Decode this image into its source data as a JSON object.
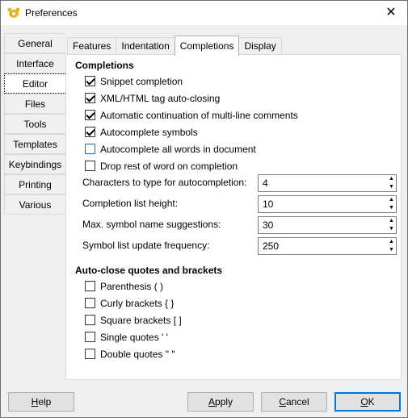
{
  "window": {
    "title": "Preferences",
    "close_glyph": "✕"
  },
  "categories": [
    {
      "label": "General"
    },
    {
      "label": "Interface"
    },
    {
      "label": "Editor"
    },
    {
      "label": "Files"
    },
    {
      "label": "Tools"
    },
    {
      "label": "Templates"
    },
    {
      "label": "Keybindings"
    },
    {
      "label": "Printing"
    },
    {
      "label": "Various"
    }
  ],
  "tabs": [
    {
      "label": "Features"
    },
    {
      "label": "Indentation"
    },
    {
      "label": "Completions"
    },
    {
      "label": "Display"
    }
  ],
  "completions": {
    "title": "Completions",
    "options": [
      {
        "label": "Snippet completion",
        "checked": true
      },
      {
        "label": "XML/HTML tag auto-closing",
        "checked": true
      },
      {
        "label": "Automatic continuation of multi-line comments",
        "checked": true
      },
      {
        "label": "Autocomplete symbols",
        "checked": true
      },
      {
        "label": "Autocomplete all words in document",
        "checked": false
      },
      {
        "label": "Drop rest of word on completion",
        "checked": false
      }
    ],
    "fields": [
      {
        "label": "Characters to type for autocompletion:",
        "value": "4"
      },
      {
        "label": "Completion list height:",
        "value": "10"
      },
      {
        "label": "Max. symbol name suggestions:",
        "value": "30"
      },
      {
        "label": "Symbol list update frequency:",
        "value": "250"
      }
    ]
  },
  "autoclose": {
    "title": "Auto-close quotes and brackets",
    "options": [
      {
        "label": "Parenthesis ( )",
        "checked": false
      },
      {
        "label": "Curly brackets { }",
        "checked": false
      },
      {
        "label": "Square brackets [ ]",
        "checked": false
      },
      {
        "label": "Single quotes ' '",
        "checked": false
      },
      {
        "label": "Double quotes \" \"",
        "checked": false
      }
    ]
  },
  "buttons": {
    "help": "Help",
    "apply": "Apply",
    "cancel": "Cancel",
    "ok": "OK"
  },
  "spin_up_glyph": "▲",
  "spin_down_glyph": "▼"
}
